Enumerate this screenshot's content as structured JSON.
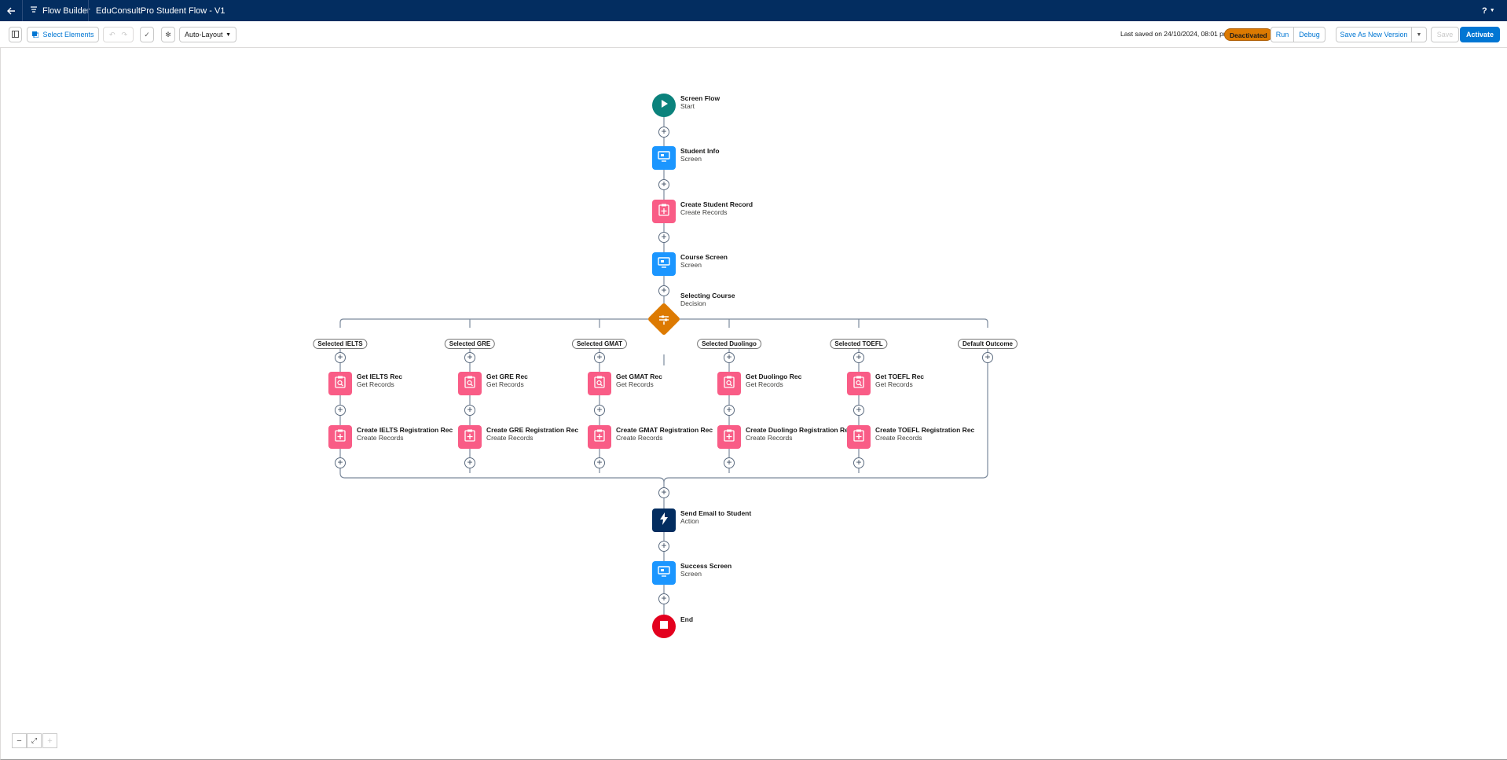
{
  "topbar": {
    "back_icon": "back-arrow-icon",
    "app_name": "Flow Builder",
    "flow_title": "EduConsultPro Student Flow - V1",
    "help_label": "?"
  },
  "toolbar": {
    "select_elements": "Select Elements",
    "layout_mode": "Auto-Layout",
    "last_saved": "Last saved on 24/10/2024, 08:01 pm",
    "status_badge": "Deactivated",
    "run": "Run",
    "debug": "Debug",
    "save_as_new": "Save As New Version",
    "save": "Save",
    "activate": "Activate"
  },
  "colors": {
    "header": "#032d60",
    "start": "#0b827c",
    "screen": "#1b96ff",
    "records": "#f95c86",
    "decision": "#dd7a01",
    "action": "#032d60",
    "end": "#e3001e",
    "activate": "#0176d3",
    "badge": "#dd7a01"
  },
  "flow": {
    "start": {
      "title": "Screen Flow",
      "sub": "Start",
      "icon": "play-icon"
    },
    "student_info": {
      "title": "Student Info",
      "sub": "Screen",
      "icon": "screen-icon"
    },
    "create_student": {
      "title": "Create Student Record",
      "sub": "Create Records",
      "icon": "create-records-icon"
    },
    "course_screen": {
      "title": "Course Screen",
      "sub": "Screen",
      "icon": "screen-icon"
    },
    "decision": {
      "title": "Selecting Course",
      "sub": "Decision",
      "icon": "decision-icon"
    },
    "branches": [
      {
        "outcome": "Selected IELTS",
        "get": {
          "title": "Get IELTS Rec",
          "sub": "Get Records"
        },
        "create": {
          "title": "Create IELTS Registration Rec",
          "sub": "Create Records"
        }
      },
      {
        "outcome": "Selected GRE",
        "get": {
          "title": "Get GRE Rec",
          "sub": "Get Records"
        },
        "create": {
          "title": "Create GRE Registration Rec",
          "sub": "Create Records"
        }
      },
      {
        "outcome": "Selected GMAT",
        "get": {
          "title": "Get GMAT Rec",
          "sub": "Get Records"
        },
        "create": {
          "title": "Create GMAT Registration Rec",
          "sub": "Create Records"
        }
      },
      {
        "outcome": "Selected Duolingo",
        "get": {
          "title": "Get Duolingo Rec",
          "sub": "Get Records"
        },
        "create": {
          "title": "Create Duolingo Registration Rec",
          "sub": "Create Records"
        }
      },
      {
        "outcome": "Selected TOEFL",
        "get": {
          "title": "Get TOEFL Rec",
          "sub": "Get Records"
        },
        "create": {
          "title": "Create TOEFL Registration Rec",
          "sub": "Create Records"
        }
      },
      {
        "outcome": "Default Outcome"
      }
    ],
    "send_email": {
      "title": "Send Email to Student",
      "sub": "Action",
      "icon": "lightning-icon"
    },
    "success_screen": {
      "title": "Success Screen",
      "sub": "Screen",
      "icon": "screen-icon"
    },
    "end": {
      "title": "End",
      "icon": "stop-icon"
    }
  },
  "zoom_controls": {
    "zoom_out_icon": "minus-icon",
    "fit_icon": "fit-view-icon",
    "zoom_in_icon": "plus-icon"
  }
}
